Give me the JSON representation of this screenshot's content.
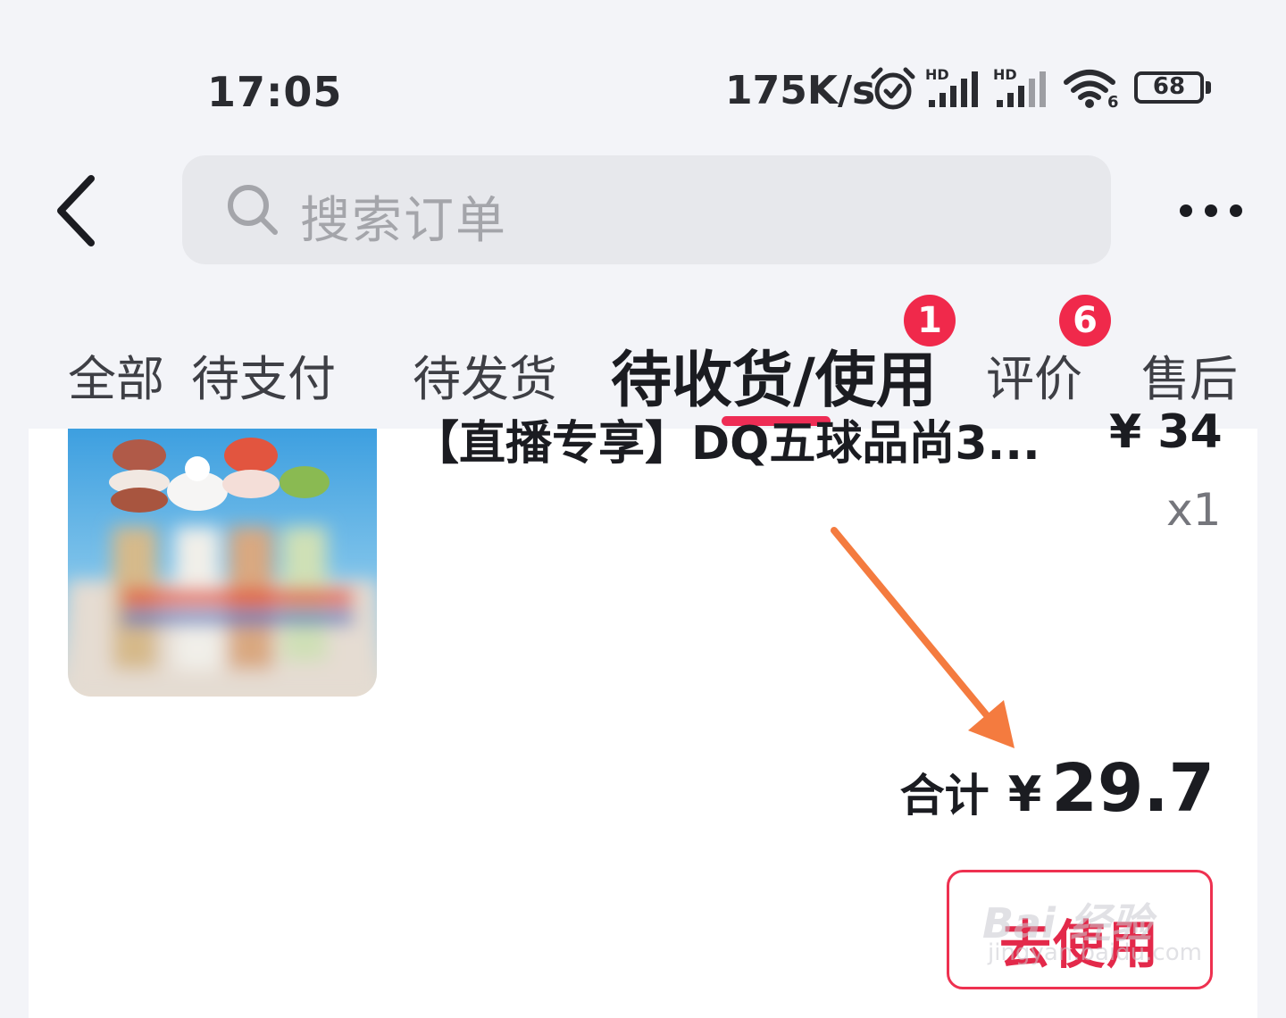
{
  "status_bar": {
    "time": "17:05",
    "network_speed": "175K/s",
    "signal_1_label": "HD",
    "signal_2_label": "HD",
    "wifi_label": "6",
    "battery_level": "68",
    "icons": [
      "alarm-icon",
      "signal-icon",
      "signal-icon",
      "wifi-icon",
      "battery-icon"
    ]
  },
  "header": {
    "back_icon": "chevron-left-icon",
    "search_placeholder": "搜索订单",
    "more_icon": "more-icon"
  },
  "tabs": [
    {
      "label": "全部",
      "badge": null,
      "active": false
    },
    {
      "label": "待支付",
      "badge": null,
      "active": false
    },
    {
      "label": "待发货",
      "badge": null,
      "active": false
    },
    {
      "label": "待收货/使用",
      "badge": "1",
      "active": true
    },
    {
      "label": "评价",
      "badge": "6",
      "active": false
    },
    {
      "label": "售后",
      "badge": null,
      "active": false
    }
  ],
  "order": {
    "product_title": "【直播专享】DQ五球品尚3...",
    "price": "¥ 34",
    "quantity": "x1",
    "total_label": "合计",
    "total_currency": "¥",
    "total_value": "29.7",
    "action_button": "去使用"
  },
  "watermark": {
    "text": "Bai 经验",
    "url": "jingyan.baidu.com"
  },
  "colors": {
    "accent": "#ee2d55",
    "badge": "#f0294b",
    "annotation_arrow": "#f47b3f"
  }
}
